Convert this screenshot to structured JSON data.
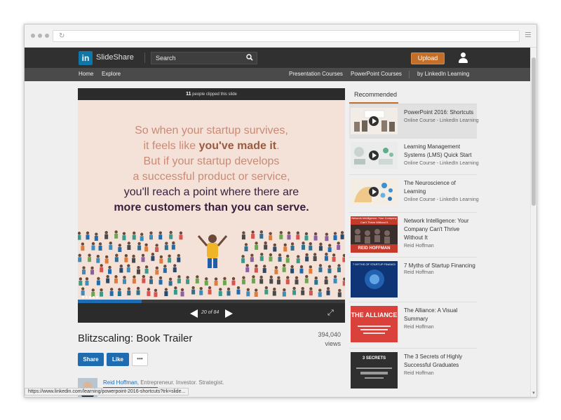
{
  "header": {
    "logo_text": "in",
    "brand": "SlideShare",
    "search_placeholder": "Search",
    "upload_label": "Upload"
  },
  "nav": {
    "left": [
      "Home",
      "Explore"
    ],
    "right": [
      "Presentation Courses",
      "PowerPoint Courses",
      "by LinkedIn Learning"
    ]
  },
  "player": {
    "clip_count": "11",
    "clip_text": "people clipped this slide",
    "slide_lines": {
      "l1": "So when your startup survives,",
      "l2a": "it feels like ",
      "l2b": "you've made it",
      "l2c": ".",
      "l3": "But if your startup develops",
      "l4": "a successful product or service,",
      "l5": "you'll reach a point where there are",
      "l6": "more customers than you can serve."
    },
    "page_indicator": "20 of 84",
    "progress": 0.24
  },
  "document": {
    "title": "Blitzscaling: Book Trailer",
    "views_count": "394,040",
    "views_label": "views",
    "share_label": "Share",
    "like_label": "Like",
    "more_label": "•••",
    "author_name": "Reid Hoffman",
    "author_desc": ", Entrepreneur. Investor. Strategist."
  },
  "status_url": "https://www.linkedin.com/learning/powerpoint-2016-shortcuts?trk=slide...",
  "recommended": {
    "tab_label": "Recommended",
    "items": [
      {
        "title": "PowerPoint 2016: Shortcuts",
        "sub": "Online Course - LinkedIn Learning"
      },
      {
        "title": "Learning Management Systems (LMS) Quick Start",
        "sub": "Online Course - LinkedIn Learning"
      },
      {
        "title": "The Neuroscience of Learning",
        "sub": "Online Course - LinkedIn Learning"
      },
      {
        "title": "Network Intelligence: Your Company Can't Thrive Without It",
        "sub": "Reid Hoffman",
        "thumb_title": "Network Intelligence: Your Company Can't Thrive Without It",
        "thumb_author": "REID HOFFMAN"
      },
      {
        "title": "7 Myths of Startup Financing",
        "sub": "Reid Hoffman",
        "thumb_title": "7 MYTHS OF STARTUP FINANCING"
      },
      {
        "title": "The Alliance: A Visual Summary",
        "sub": "Reid Hoffman",
        "thumb_title": "THE ALLIANCE"
      },
      {
        "title": "The 3 Secrets of Highly Successful Graduates",
        "sub": "Reid Hoffman",
        "thumb_title": "3 SECRETS"
      }
    ]
  },
  "colors": {
    "accent": "#c36f2a",
    "link": "#1f6cb0",
    "header_bg": "#303030",
    "slide_bg": "#f4e2d8"
  }
}
